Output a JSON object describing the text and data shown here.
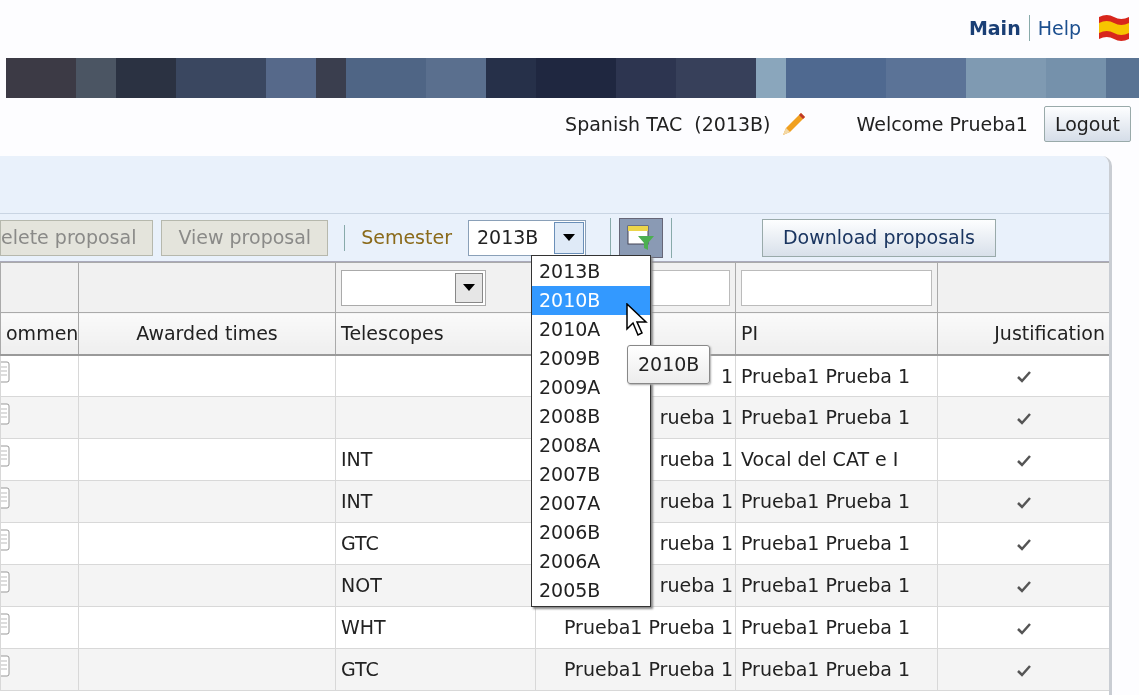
{
  "top_nav": [
    {
      "label": "Main",
      "active": true
    },
    {
      "label": "Help",
      "active": false
    }
  ],
  "header": {
    "title": "Spanish TAC  (2013B)",
    "welcome": "Welcome Prueba1",
    "logout": "Logout"
  },
  "toolbar": {
    "buttons": [
      {
        "label": "elete proposal",
        "disabled": true
      },
      {
        "label": "View proposal",
        "disabled": true
      }
    ],
    "semester_label": "Semester",
    "semester_value": "2013B",
    "download": {
      "label": "Download proposals"
    }
  },
  "semester_options": [
    {
      "label": "2013B",
      "selected": false
    },
    {
      "label": "2010B",
      "selected": true
    },
    {
      "label": "2010A",
      "selected": false
    },
    {
      "label": "2009B",
      "selected": false
    },
    {
      "label": "2009A",
      "selected": false
    },
    {
      "label": "2008B",
      "selected": false
    },
    {
      "label": "2008A",
      "selected": false
    },
    {
      "label": "2007B",
      "selected": false
    },
    {
      "label": "2007A",
      "selected": false
    },
    {
      "label": "2006B",
      "selected": false
    },
    {
      "label": "2006A",
      "selected": false
    },
    {
      "label": "2005B",
      "selected": false
    }
  ],
  "tooltip": "2010B",
  "table": {
    "columns": [
      {
        "label": "ommen",
        "kind": "plain"
      },
      {
        "label": "Awarded times",
        "kind": "plain"
      },
      {
        "label": "Telescopes",
        "kind": "select"
      },
      {
        "kind": "text"
      },
      {
        "label": "PI",
        "kind": "text"
      },
      {
        "label": "Justification",
        "kind": "plain"
      }
    ],
    "rows": [
      {
        "column_4": "1",
        "pi": "Prueba1 Prueba 1",
        "justified": true
      },
      {
        "column_4": "rueba 1",
        "pi": "Prueba1 Prueba 1",
        "justified": true
      },
      {
        "telescope": "INT",
        "column_4": "rueba 1",
        "pi": "Vocal del CAT e I",
        "justified": true
      },
      {
        "telescope": "INT",
        "column_4": "rueba 1",
        "pi": "Prueba1 Prueba 1",
        "justified": true
      },
      {
        "telescope": "GTC",
        "column_4": "rueba 1",
        "pi": "Prueba1 Prueba 1",
        "justified": true
      },
      {
        "telescope": "NOT",
        "column_4": "rueba 1",
        "pi": "Prueba1 Prueba 1",
        "justified": true
      },
      {
        "telescope": "WHT",
        "column_4": "Prueba1 Prueba 1",
        "pi": "Prueba1 Prueba 1",
        "justified": true
      },
      {
        "telescope": "GTC",
        "column_4": "Prueba1 Prueba 1",
        "pi": "Prueba1 Prueba 1",
        "justified": true
      }
    ]
  }
}
